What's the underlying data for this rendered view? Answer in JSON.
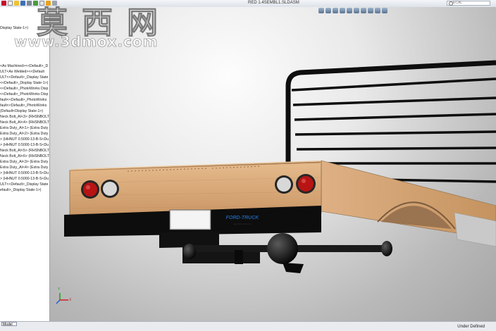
{
  "window": {
    "title": "RED 1.4SEMBL1.SLDASM",
    "help_search_placeholder": "ECAL"
  },
  "heads_up_icons": [
    "zoom-fit-icon",
    "zoom-area-icon",
    "previous-view-icon",
    "section-view-icon",
    "view-orientation-icon",
    "display-style-icon",
    "hide-show-icon",
    "edit-appearance-icon",
    "scene-icon",
    "view-settings-icon"
  ],
  "feature_tree": {
    "header": "Display State-1>)",
    "items": [
      "<As Machined><<Default>_D",
      "ULT<As Welded><<Default",
      "ULT<<Default>_Display State",
      "<<Default>_Display State-1>)",
      "<<Default>_PhotoWorks Disp",
      "<<Default>_PhotoWorks Disp",
      "fault<<Default>_PhotoWorks",
      "fault<<Default>_PhotoWorks",
      "(Default<Display State-1>)",
      "Neck Bolt_AI<3> (RHSNBOLT",
      "Neck Bolt_AI<4> (RHSNBOLT",
      "Extra Duty_AI<1> (Extra Duty L",
      "Extra Duty_AI<2> (Extra Duty L",
      "> (HHNUT 0.5000-13-B-S<Du",
      "> (HHNUT 0.5000-13-B-S<Du",
      "Neck Bolt_AI<5> (RHSNBOLT",
      "Neck Bolt_AI<6> (RHSNBOLT",
      "Extra Duty_AI<3> (Extra Duty L",
      "Extra Duty_AI<4> (Extra Duty L",
      "> (HHNUT 0.5000-13-B-S<Du",
      "> (HHNUT 0.5000-13-B-S<Du",
      "ULT<<Default>_Display State",
      "efault>_Display State-1>)"
    ]
  },
  "viewport": {
    "watermark_cn": "莫西网",
    "watermark_url": "www.3dmox.com",
    "badge_brand": "FORD-TRUCK",
    "badge_sub": "www.ford-truck.com",
    "axis_labels": {
      "x": "X",
      "y": "Y"
    }
  },
  "bottom_tabs": [
    "Model"
  ],
  "status": "Under Defined",
  "colors": {
    "wood": "#d9a979",
    "wood_dark": "#a87d55",
    "frame": "#0e0e0e",
    "tail_light_red": "#b81414",
    "selection_blue": "#1f5fa8"
  }
}
